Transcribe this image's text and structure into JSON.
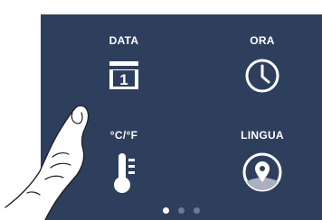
{
  "settings_grid": {
    "items": [
      {
        "id": "date",
        "label": "DATA",
        "icon": "calendar-icon",
        "calendar_day": "1"
      },
      {
        "id": "time",
        "label": "ORA",
        "icon": "clock-icon"
      },
      {
        "id": "units",
        "label": "°C/°F",
        "icon": "thermometer-icon"
      },
      {
        "id": "language",
        "label": "LINGUA",
        "icon": "location-pin-icon"
      }
    ]
  },
  "pagination": {
    "pages": 3,
    "active_page": 1
  },
  "colors": {
    "screen_bg": "#2e3f5e",
    "foreground": "#ffffff",
    "dot_inactive": "#6d7a92"
  },
  "overlay": {
    "icon": "pointing-hand-icon"
  }
}
